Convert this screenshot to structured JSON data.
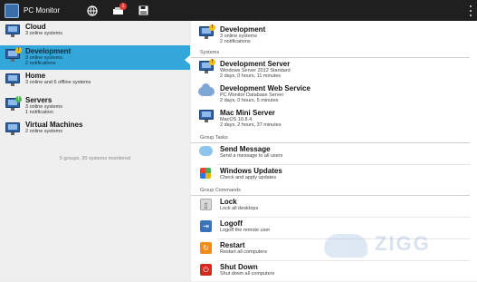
{
  "app": {
    "title": "PC Monitor",
    "notification_count": "1"
  },
  "groups": [
    {
      "name": "Cloud",
      "sub1": "3 online systems",
      "sub2": "",
      "warn": false
    },
    {
      "name": "Development",
      "sub1": "3 online systems",
      "sub2": "2 notifications",
      "warn": true,
      "selected": true
    },
    {
      "name": "Home",
      "sub1": "3 online and 6 offline systems",
      "sub2": "",
      "warn": false
    },
    {
      "name": "Servers",
      "sub1": "3 online systems",
      "sub2": "1 notification",
      "warn": true
    },
    {
      "name": "Virtual Machines",
      "sub1": "2 online systems",
      "sub2": "",
      "warn": false
    }
  ],
  "groups_footer": "5 groups, 20 systems monitored",
  "detail": {
    "header": {
      "name": "Development",
      "sub1": "3 online systems",
      "sub2": "2 notifications"
    },
    "systems_label": "Systems",
    "systems": [
      {
        "name": "Development Server",
        "sub1": "Windows Server 2012 Standard",
        "sub2": "2 days, 0 hours, 11 minutes",
        "icon": "monitor-icon",
        "warn": true
      },
      {
        "name": "Development Web Service",
        "sub1": "PC Monitor Database Server",
        "sub2": "2 days, 0 hours, 5 minutes",
        "icon": "cloud-icon",
        "warn": false
      },
      {
        "name": "Mac Mini Server",
        "sub1": "MacOS 10.8.4",
        "sub2": "2 days, 2 hours, 37 minutes",
        "icon": "monitor-icon",
        "warn": false
      }
    ],
    "tasks_label": "Group Tasks",
    "tasks": [
      {
        "name": "Send Message",
        "sub": "Send a message to all users",
        "icon": "chat-bubble-icon"
      },
      {
        "name": "Windows Updates",
        "sub": "Check and apply updates",
        "icon": "windows-icon"
      }
    ],
    "commands_label": "Group Commands",
    "commands": [
      {
        "name": "Lock",
        "sub": "Lock all desktops",
        "icon": "lock-icon",
        "glyph": "▯"
      },
      {
        "name": "Logoff",
        "sub": "Logoff the remote user",
        "icon": "logoff-icon",
        "glyph": "⇥"
      },
      {
        "name": "Restart",
        "sub": "Restart all computers",
        "icon": "restart-icon",
        "glyph": "↻"
      },
      {
        "name": "Shut Down",
        "sub": "Shut down all computers",
        "icon": "power-icon",
        "glyph": "⏻"
      }
    ]
  },
  "watermark": "ZIGG"
}
